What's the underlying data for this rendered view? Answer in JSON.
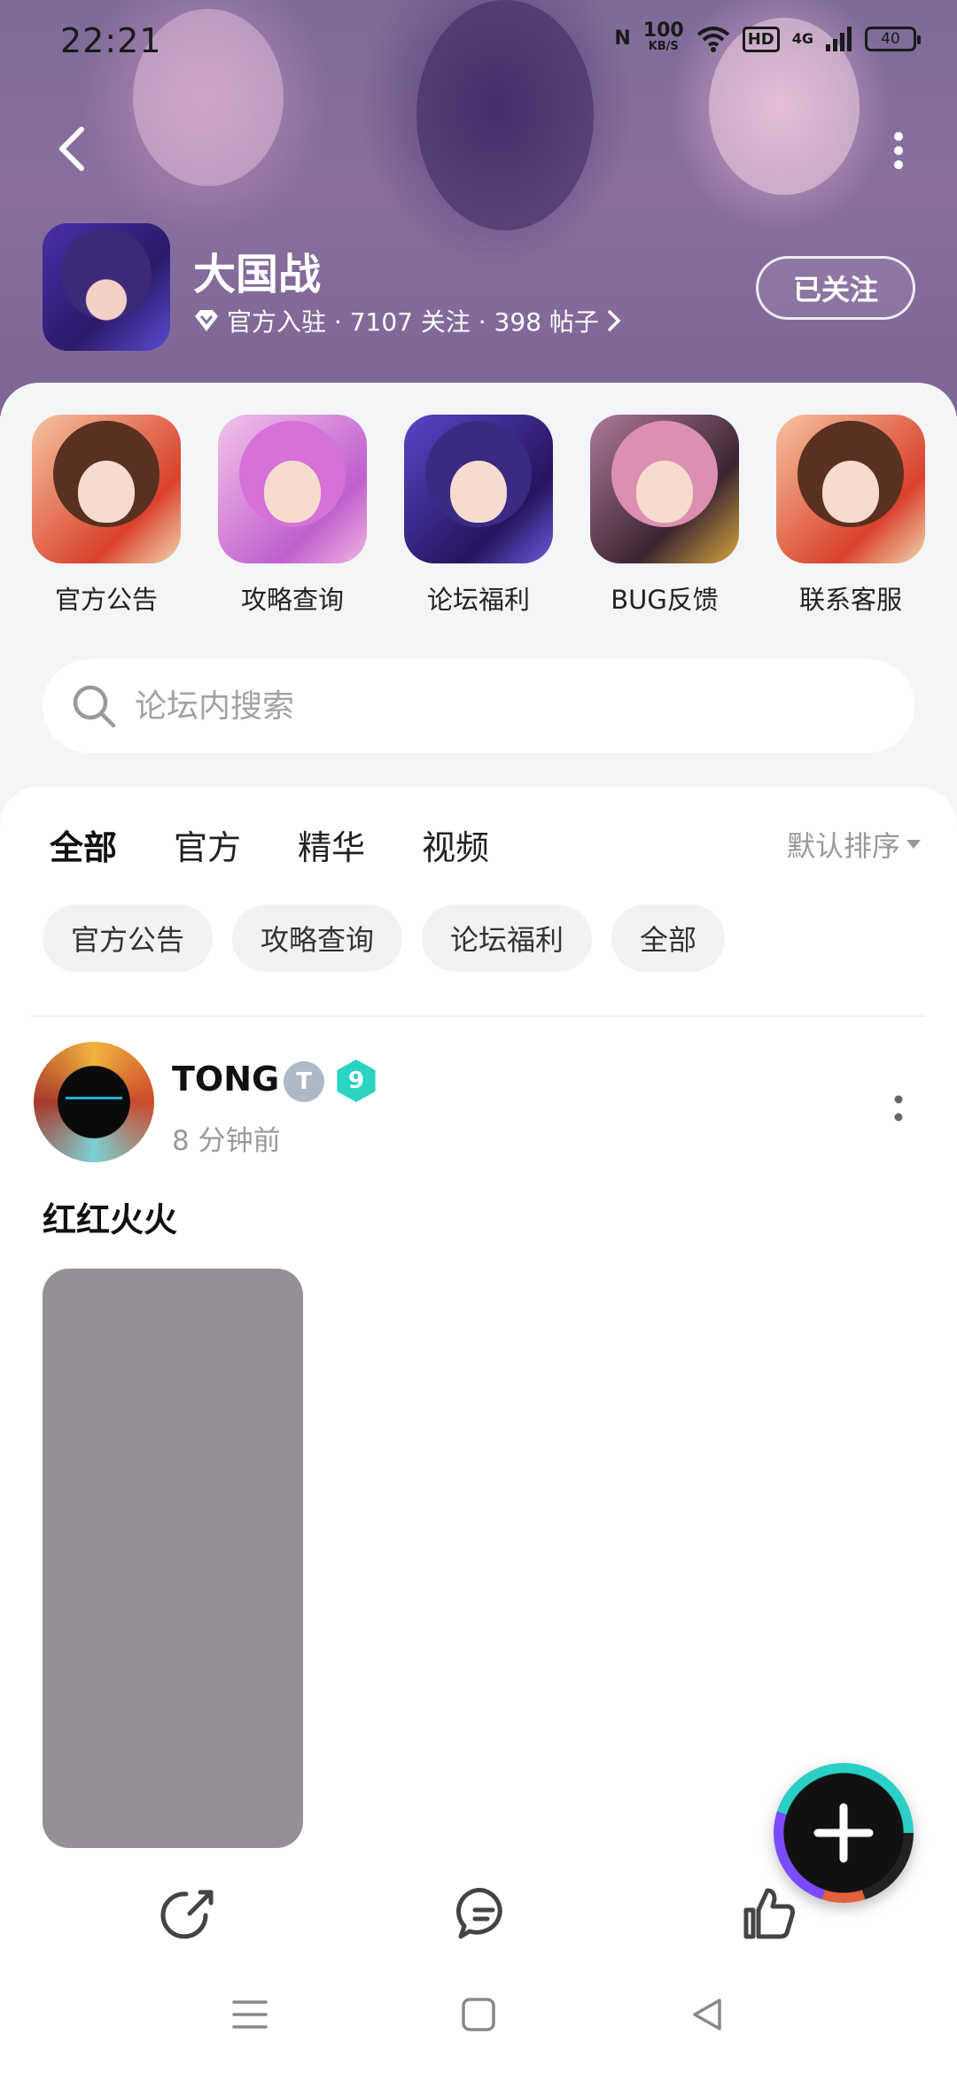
{
  "status_bar": {
    "time": "22:21",
    "nfc": "N",
    "net_speed": "100",
    "net_speed_unit": "KB/S",
    "hd": "HD",
    "signal": "4G",
    "battery": "40"
  },
  "game": {
    "title": "大国战",
    "meta": "官方入驻 · 7107 关注 · 398 帖子",
    "follow_label": "已关注"
  },
  "quick_links": [
    {
      "label": "官方公告"
    },
    {
      "label": "攻略查询"
    },
    {
      "label": "论坛福利"
    },
    {
      "label": "BUG反馈"
    },
    {
      "label": "联系客服"
    }
  ],
  "search": {
    "placeholder": "论坛内搜索"
  },
  "tabs": [
    {
      "label": "全部",
      "active": true
    },
    {
      "label": "官方"
    },
    {
      "label": "精华"
    },
    {
      "label": "视频"
    }
  ],
  "sort_label": "默认排序",
  "chips": [
    "官方公告",
    "攻略查询",
    "论坛福利",
    "全部"
  ],
  "post": {
    "author": "TONG",
    "badge_letter": "T",
    "level": "9",
    "time": "8 分钟前",
    "text": "红红火火"
  },
  "colors": {
    "accent": "#2ad0c5",
    "header_bg": "#8a6f9e",
    "image_placeholder": "#968f96"
  },
  "icons": [
    "back-icon",
    "more-vertical-icon",
    "diamond-icon",
    "chevron-right-icon",
    "search-icon",
    "caret-down-icon",
    "share-icon",
    "comment-icon",
    "like-icon",
    "plus-icon",
    "menu-icon",
    "home-icon",
    "back-triangle-icon"
  ]
}
